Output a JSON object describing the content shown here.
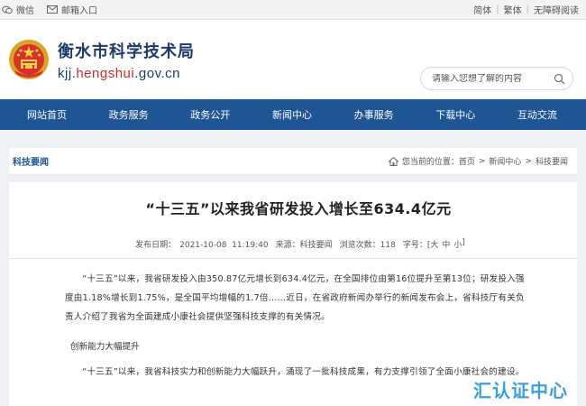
{
  "topbar": {
    "weibo_label": "微信",
    "mailbox_label": "邮箱入口",
    "lang_simplified": "简体",
    "lang_traditional": "繁体",
    "accessibility": "无障碍阅读"
  },
  "header": {
    "title": "衡水市科学技术局",
    "url_prefix": "kjj.",
    "url_domain": "hengshui",
    "url_suffix": ".gov.cn"
  },
  "search": {
    "placeholder": "请输入您想了解的内容"
  },
  "nav": {
    "items": [
      "网站首页",
      "政务服务",
      "政务公开",
      "新闻中心",
      "办事服务",
      "下载中心",
      "互动交流"
    ]
  },
  "breadcrumb": {
    "section": "科技要闻",
    "prefix": "您当前的位置：",
    "home": "首页",
    "level1": "新闻中心",
    "level2": "科技要闻",
    "arrow": ">"
  },
  "article": {
    "title": "“十三五”以来我省研发投入增长至634.4亿元",
    "published_label": "发布日期：",
    "published": "2021-10-08  11:19:40",
    "source_label": "来源：",
    "source": "科技要闻",
    "views_label": "浏览次数：",
    "views": "118",
    "font_label": "字号：[",
    "font_large": "大",
    "font_medium": "中",
    "font_small": "小",
    "font_end": "]",
    "p1": "“十三五”以来，我省研发投入由350.87亿元增长到634.4亿元，在全国排位由第16位提升至第13位；研发投入强度由1.18%增长到1.75%，是全国平均增幅的1.7倍……近日，在省政府新闻办举行的新闻发布会上，省科技厅有关负责人介绍了我省为全面建成小康社会提供坚强科技支撑的有关情况。",
    "subheading": "创新能力大幅提升",
    "p2": "“十三五”以来，我省科技实力和创新能力大幅跃升，涌现了一批科技成果，有力支撑引领了全面小康社会的建设。"
  },
  "watermark": "汇认证中心"
}
